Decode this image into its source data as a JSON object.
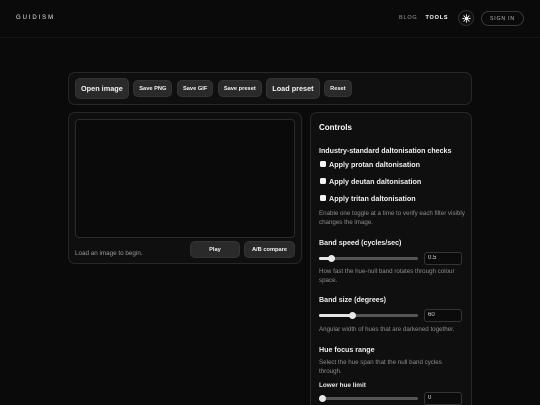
{
  "header": {
    "logo": "GUIDISM",
    "nav": [
      {
        "label": "BLOG",
        "active": false
      },
      {
        "label": "TOOLS",
        "active": true
      }
    ],
    "theme_toggle_icon": "sun-icon",
    "sign_in_label": "SIGN IN"
  },
  "toolbar": {
    "open_image": "Open image",
    "save_png": "Save PNG",
    "save_gif": "Save GIF",
    "save_preset": "Save preset",
    "load_preset": "Load preset",
    "reset": "Reset"
  },
  "preview": {
    "status": "Load an image to begin.",
    "play_label": "Play",
    "compare_label": "A/B compare"
  },
  "controls": {
    "title": "Controls",
    "daltonisation": {
      "heading": "Industry-standard daltonisation checks",
      "options": [
        {
          "label": "Apply protan daltonisation",
          "checked": false
        },
        {
          "label": "Apply deutan daltonisation",
          "checked": false
        },
        {
          "label": "Apply tritan daltonisation",
          "checked": false
        }
      ],
      "help": "Enable one toggle at a time to verify each filter visibly changes the image."
    },
    "band_speed": {
      "label": "Band speed (cycles/sec)",
      "value": "0.5",
      "level": 0.1,
      "help": "How fast the hue-null band rotates through colour space."
    },
    "band_size": {
      "label": "Band size (degrees)",
      "value": "60",
      "level": 0.33,
      "help": "Angular width of hues that are darkened together."
    },
    "hue_focus": {
      "heading": "Hue focus range",
      "help": "Select the hue span that the null band cycles through.",
      "lower": {
        "label": "Lower hue limit",
        "value": "0",
        "level": 0
      }
    }
  },
  "colors": {
    "background": "#0a0a0a",
    "panel": "#0f0f0f",
    "button": "#2a2a2a",
    "text": "#f2f2f2",
    "muted_text": "#8c8c8c"
  }
}
